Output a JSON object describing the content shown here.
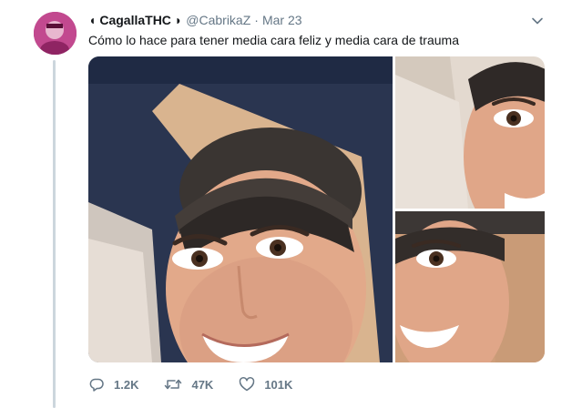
{
  "tweet": {
    "display_name": "◖ CagallaTHC ◗",
    "handle": "@CabrikaZ",
    "separator": "·",
    "date": "Mar 23",
    "text": "Cómo lo hace para tener media cara feliz y media cara de trauma",
    "media": {
      "images": [
        "main-selfie-photo",
        "selfie-crop-top-right",
        "selfie-crop-bottom-right"
      ]
    },
    "actions": {
      "reply_count": "1.2K",
      "retweet_count": "47K",
      "like_count": "101K"
    },
    "icons": [
      "chevron-down-icon",
      "reply-icon",
      "retweet-icon",
      "like-icon"
    ]
  },
  "colors": {
    "primary_text": "#14171a",
    "secondary_text": "#657786",
    "thread_line": "#ccd6dd"
  }
}
